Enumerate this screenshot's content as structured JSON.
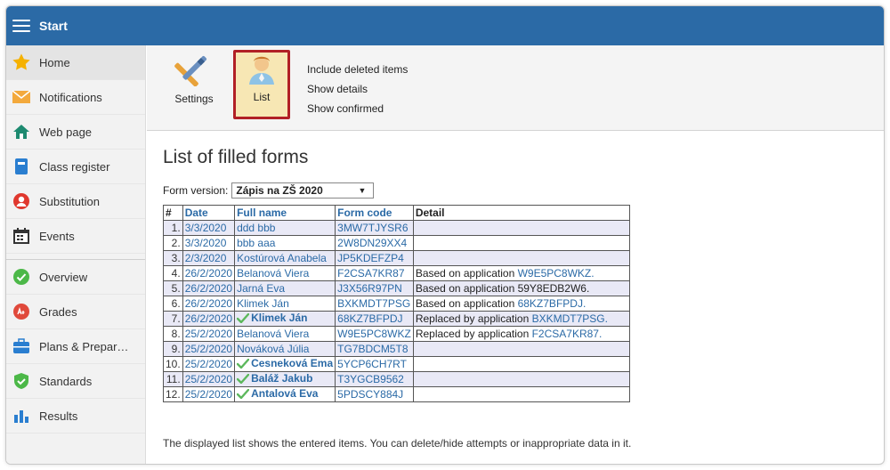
{
  "header": {
    "title": "Start"
  },
  "sidebar": {
    "items": [
      {
        "label": "Home",
        "icon": "star-icon",
        "active": true
      },
      {
        "label": "Notifications",
        "icon": "envelope-icon"
      },
      {
        "label": "Web page",
        "icon": "house-icon"
      },
      {
        "label": "Class register",
        "icon": "book-icon"
      },
      {
        "label": "Substitution",
        "icon": "person-icon"
      },
      {
        "label": "Events",
        "icon": "calendar-icon"
      },
      {
        "label": "Overview",
        "icon": "check-circle-icon"
      },
      {
        "label": "Grades",
        "icon": "grades-icon"
      },
      {
        "label": "Plans & Prepar…",
        "icon": "briefcase-icon"
      },
      {
        "label": "Standards",
        "icon": "shield-check-icon"
      },
      {
        "label": "Results",
        "icon": "bar-chart-icon"
      }
    ]
  },
  "toolbar": {
    "settings_label": "Settings",
    "list_label": "List",
    "options": [
      "Include deleted items",
      "Show details",
      "Show confirmed"
    ]
  },
  "main": {
    "title": "List of filled forms",
    "form_version_label": "Form version:",
    "form_version_value": "Zápis na ZŠ 2020",
    "columns": [
      "#",
      "Date",
      "Full name",
      "Form code",
      "Detail"
    ],
    "rows": [
      {
        "num": "1.",
        "date": "3/3/2020",
        "name": "ddd bbb",
        "code": "3MW7TJYSR6",
        "detail_text": "",
        "detail_link": "",
        "confirmed": false
      },
      {
        "num": "2.",
        "date": "3/3/2020",
        "name": "bbb aaa",
        "code": "2W8DN29XX4",
        "detail_text": "",
        "detail_link": "",
        "confirmed": false
      },
      {
        "num": "3.",
        "date": "2/3/2020",
        "name": "Kostúrová Anabela",
        "code": "JP5KDEFZP4",
        "detail_text": "",
        "detail_link": "",
        "confirmed": false
      },
      {
        "num": "4.",
        "date": "26/2/2020",
        "name": "Belanová Viera",
        "code": "F2CSA7KR87",
        "detail_text": "Based on application ",
        "detail_link": "W9E5PC8WKZ.",
        "confirmed": false
      },
      {
        "num": "5.",
        "date": "26/2/2020",
        "name": "Jarná Eva",
        "code": "J3X56R97PN",
        "detail_text": "Based on application 59Y8EDB2W6.",
        "detail_link": "",
        "confirmed": false
      },
      {
        "num": "6.",
        "date": "26/2/2020",
        "name": "Klimek Ján",
        "code": "BXKMDT7PSG",
        "detail_text": "Based on application ",
        "detail_link": "68KZ7BFPDJ.",
        "confirmed": false
      },
      {
        "num": "7.",
        "date": "26/2/2020",
        "name": "Klimek Ján",
        "code": "68KZ7BFPDJ",
        "detail_text": "Replaced by application ",
        "detail_link": "BXKMDT7PSG.",
        "confirmed": true
      },
      {
        "num": "8.",
        "date": "25/2/2020",
        "name": "Belanová Viera",
        "code": "W9E5PC8WKZ",
        "detail_text": "Replaced by application ",
        "detail_link": "F2CSA7KR87.",
        "confirmed": false
      },
      {
        "num": "9.",
        "date": "25/2/2020",
        "name": "Nováková Júlia",
        "code": "TG7BDCM5T8",
        "detail_text": "",
        "detail_link": "",
        "confirmed": false
      },
      {
        "num": "10.",
        "date": "25/2/2020",
        "name": "Cesneková Ema",
        "code": "5YCP6CH7RT",
        "detail_text": "",
        "detail_link": "",
        "confirmed": true
      },
      {
        "num": "11.",
        "date": "25/2/2020",
        "name": "Baláž Jakub",
        "code": "T3YGCB9562",
        "detail_text": "",
        "detail_link": "",
        "confirmed": true
      },
      {
        "num": "12.",
        "date": "25/2/2020",
        "name": "Antalová Eva",
        "code": "5PDSCY884J",
        "detail_text": "",
        "detail_link": "",
        "confirmed": true
      }
    ],
    "footnote": "The displayed list shows the entered items. You can delete/hide attempts or inappropriate data in it."
  },
  "colors": {
    "header": "#2b6aa6",
    "link": "#2b6aa6",
    "row_alt": "#e9e9f6",
    "highlight_border": "#b12025",
    "list_bg": "#f7e7b4",
    "check": "#5cb85c"
  }
}
